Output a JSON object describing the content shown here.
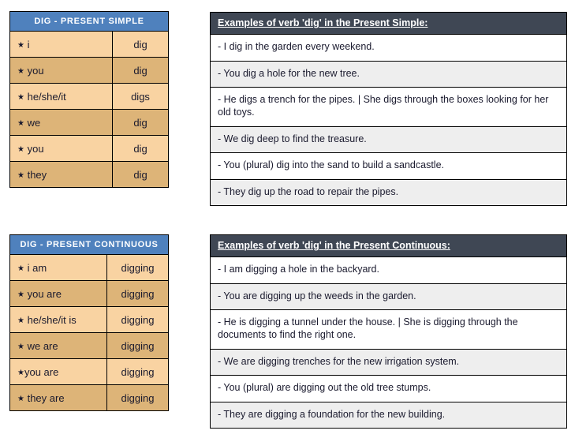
{
  "page": {
    "background_color": "#ffffff",
    "accent_blue": "#4f81bd",
    "accent_dark": "#3f4754",
    "row_light": "#f9d3a2",
    "row_dark": "#ddb478",
    "example_row_gray": "#eeeeee"
  },
  "blocks": [
    {
      "id": "present-simple",
      "conjugation": {
        "title": "DIG - PRESENT SIMPLE",
        "rows": [
          {
            "bullet": "★",
            "pronoun": "i",
            "form": "dig"
          },
          {
            "bullet": "★",
            "pronoun": "you",
            "form": "dig"
          },
          {
            "bullet": "★",
            "pronoun": "he/she/it",
            "form": "digs"
          },
          {
            "bullet": "★",
            "pronoun": "we",
            "form": "dig"
          },
          {
            "bullet": "★",
            "pronoun": "you",
            "form": "dig"
          },
          {
            "bullet": "★",
            "pronoun": "they",
            "form": "dig"
          }
        ]
      },
      "examples": {
        "title": "Examples of verb 'dig' in the Present Simple:",
        "rows": [
          "- I dig in the garden every weekend.",
          "- You dig a hole for the new tree.",
          "- He digs a trench for the pipes. | She digs through the boxes looking for her old toys.",
          "- We dig deep to find the treasure.",
          "- You (plural) dig into the sand to build a sandcastle.",
          "- They dig up the road to repair the pipes."
        ]
      }
    },
    {
      "id": "present-continuous",
      "conjugation": {
        "title": "DIG - PRESENT CONTINUOUS",
        "rows": [
          {
            "bullet": "★",
            "pronoun": "i am",
            "form": "digging"
          },
          {
            "bullet": "★",
            "pronoun": "you are",
            "form": "digging"
          },
          {
            "bullet": "★",
            "pronoun": "he/she/it is",
            "form": "digging"
          },
          {
            "bullet": "★",
            "pronoun": "we are",
            "form": "digging"
          },
          {
            "bullet": "★",
            "pronoun": "you are",
            "form": "digging"
          },
          {
            "bullet": "★",
            "pronoun": "they are",
            "form": "digging"
          }
        ]
      },
      "examples": {
        "title": "Examples of verb 'dig' in the Present Continuous:",
        "rows": [
          "- I am digging a hole in the backyard.",
          "- You are digging up the weeds in the garden.",
          "- He is digging a tunnel under the house. | She is digging through the documents to find the right one.",
          "- We are digging trenches for the new irrigation system.",
          "- You (plural) are digging out the old tree stumps.",
          "- They are digging a foundation for the new building."
        ]
      }
    }
  ]
}
